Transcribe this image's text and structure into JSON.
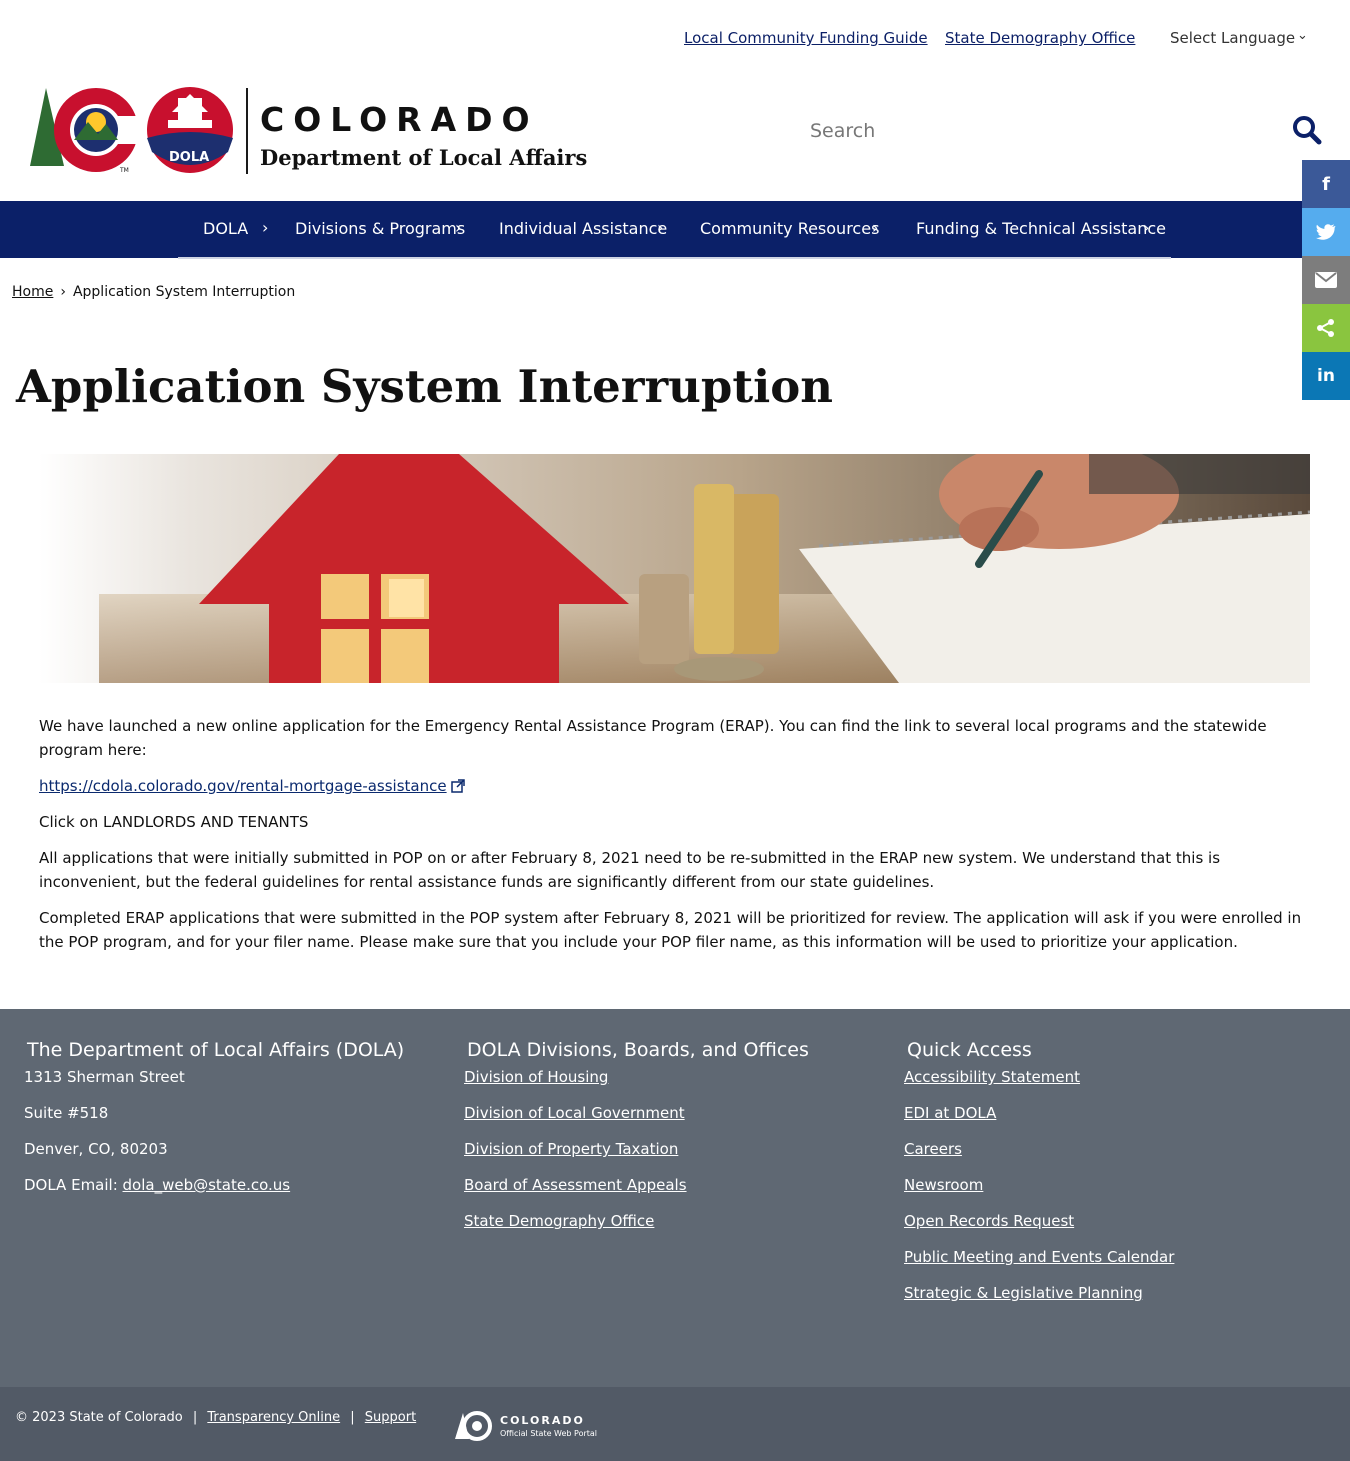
{
  "utility": {
    "links": [
      "Local Community Funding Guide",
      "State Demography Office"
    ],
    "language_label": "Select Language"
  },
  "header": {
    "state_name": "COLORADO",
    "department_name": "Department of Local Affairs",
    "dola_badge": "DOLA",
    "search_placeholder": "Search"
  },
  "nav": {
    "items": [
      "DOLA",
      "Divisions & Programs",
      "Individual Assistance",
      "Community Resources",
      "Funding & Technical Assistance"
    ]
  },
  "share": {
    "buttons": [
      {
        "name": "facebook",
        "glyph": "f",
        "color": "#3b5998"
      },
      {
        "name": "twitter",
        "glyph": "t",
        "color": "#55acee"
      },
      {
        "name": "email",
        "glyph": "✉",
        "color": "#7d7d7d"
      },
      {
        "name": "share",
        "glyph": "<",
        "color": "#8ac53f"
      },
      {
        "name": "linkedin",
        "glyph": "in",
        "color": "#0b77b5"
      }
    ]
  },
  "breadcrumb": {
    "home": "Home",
    "separator": "›",
    "current": "Application System Interruption"
  },
  "page": {
    "title": "Application System Interruption",
    "paragraph_1": "We have launched a new online application for the Emergency Rental Assistance Program (ERAP). You can find the link to several local programs and the statewide program here:",
    "link": "https://cdola.colorado.gov/rental-mortgage-assistance",
    "paragraph_2": "Click on LANDLORDS AND TENANTS",
    "paragraph_3": "All applications that were initially submitted in POP on or after February 8, 2021 need to be re-submitted in the ERAP new system. We understand that this is inconvenient, but the federal guidelines for rental assistance funds are significantly different from our state guidelines.",
    "paragraph_4": "Completed ERAP applications that were submitted in the POP system after February 8, 2021 will be prioritized for review.  The application will ask if you were enrolled in the POP program, and for your filer name. Please make sure that you include your POP filer name, as this information will be used to prioritize your application."
  },
  "footer": {
    "col1": {
      "heading": "The Department of Local Affairs (DOLA)",
      "address_1": "1313 Sherman Street",
      "address_2": "Suite  #518",
      "address_3": "Denver, CO, 80203",
      "email_label": "DOLA Email: ",
      "email": "dola_web@state.co.us"
    },
    "col2": {
      "heading": "DOLA Divisions, Boards, and Offices",
      "links": [
        "Division of Housing",
        "Division of Local Government",
        "Division of Property Taxation",
        "Board of Assessment Appeals",
        "State Demography Office"
      ]
    },
    "col3": {
      "heading": "Quick Access",
      "links": [
        "Accessibility Statement",
        "EDI at DOLA",
        "Careers",
        "Newsroom",
        "Open Records Request",
        "Public Meeting and Events Calendar",
        "Strategic & Legislative Planning"
      ]
    }
  },
  "bottom": {
    "copyright": "© 2023 State of Colorado",
    "separator": "|",
    "links": [
      "Transparency Online",
      "Support"
    ],
    "portal_name": "COLORADO",
    "portal_sub": "Official State Web Portal"
  },
  "colors": {
    "nav_bg": "#0b2068",
    "footer_bg": "#5f6873",
    "bottom_bg": "#525a66",
    "brand_red": "#c8102e",
    "brand_blue": "#0b2068",
    "brand_gold": "#ffc72c"
  }
}
